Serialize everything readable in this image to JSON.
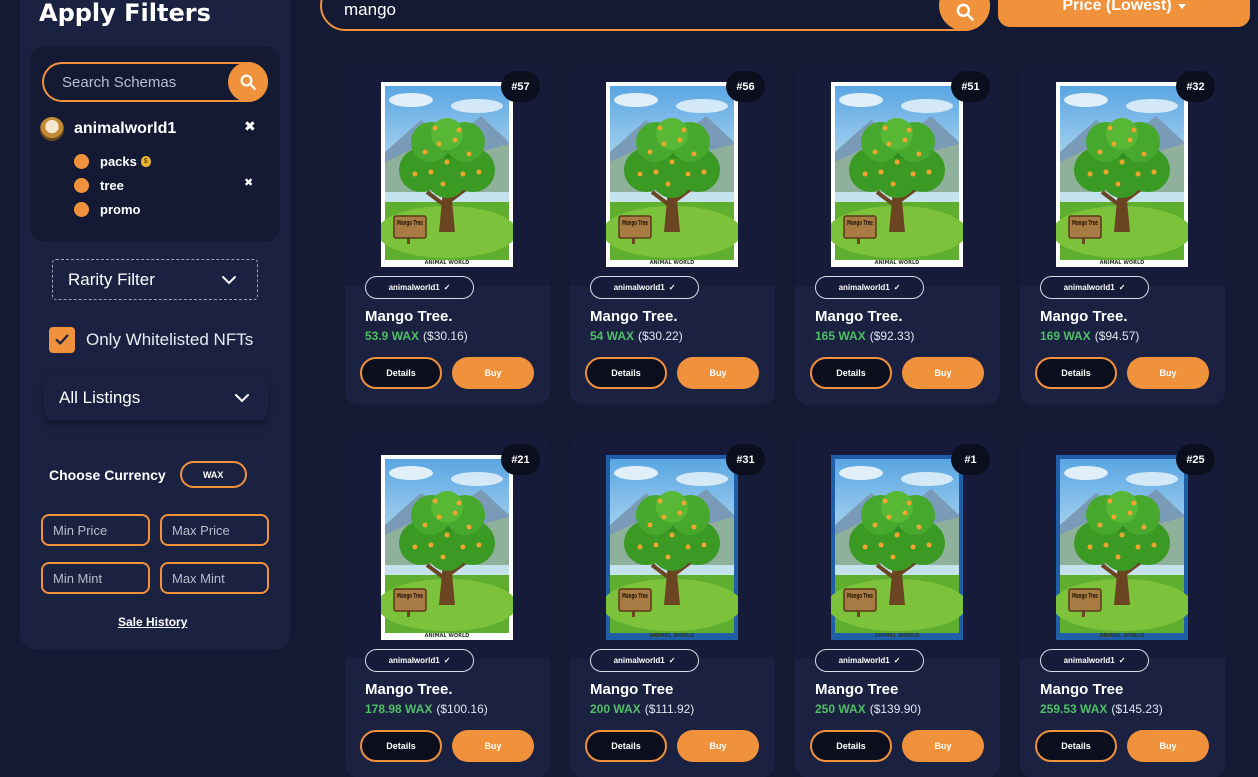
{
  "sidebar": {
    "title": "Apply Filters",
    "schema_search": {
      "placeholder": "Search Schemas"
    },
    "collection": {
      "name": "animalworld1"
    },
    "schemas": [
      {
        "label": "packs",
        "has_coin_icon": true,
        "removable": false
      },
      {
        "label": "tree",
        "has_coin_icon": false,
        "removable": true
      },
      {
        "label": "promo",
        "has_coin_icon": false,
        "removable": false
      }
    ],
    "rarity_filter": "Rarity Filter",
    "whitelisted": {
      "label": "Only Whitelisted NFTs",
      "checked": true
    },
    "listings": "All Listings",
    "currency": {
      "label": "Choose Currency",
      "value": "WAX"
    },
    "min_price": "Min Price",
    "max_price": "Max Price",
    "min_mint": "Min Mint",
    "max_mint": "Max Mint",
    "sale_history": "Sale History"
  },
  "search": {
    "value": "mango"
  },
  "sort": {
    "label": "Price (Lowest)"
  },
  "cards": [
    {
      "mint": "#57",
      "collection": "animalworld1",
      "name": "Mango Tree.",
      "wax": "53.9 WAX",
      "usd": "($30.16)",
      "frame": "white"
    },
    {
      "mint": "#56",
      "collection": "animalworld1",
      "name": "Mango Tree.",
      "wax": "54 WAX",
      "usd": "($30.22)",
      "frame": "white"
    },
    {
      "mint": "#51",
      "collection": "animalworld1",
      "name": "Mango Tree.",
      "wax": "165 WAX",
      "usd": "($92.33)",
      "frame": "white"
    },
    {
      "mint": "#32",
      "collection": "animalworld1",
      "name": "Mango Tree.",
      "wax": "169 WAX",
      "usd": "($94.57)",
      "frame": "white"
    },
    {
      "mint": "#21",
      "collection": "animalworld1",
      "name": "Mango Tree.",
      "wax": "178.98 WAX",
      "usd": "($100.16)",
      "frame": "white"
    },
    {
      "mint": "#31",
      "collection": "animalworld1",
      "name": "Mango Tree",
      "wax": "200 WAX",
      "usd": "($111.92)",
      "frame": "blue"
    },
    {
      "mint": "#1",
      "collection": "animalworld1",
      "name": "Mango Tree",
      "wax": "250 WAX",
      "usd": "($139.90)",
      "frame": "blue"
    },
    {
      "mint": "#25",
      "collection": "animalworld1",
      "name": "Mango Tree",
      "wax": "259.53 WAX",
      "usd": "($145.23)",
      "frame": "blue"
    }
  ],
  "card_labels": {
    "details": "Details",
    "buy": "Buy",
    "sign_text": "Mango Tree",
    "footer_text": "ANIMAL WORLD"
  },
  "colors": {
    "accent": "#f0913b",
    "background": "#141a33",
    "panel": "#1b2141",
    "wax_green": "#4fbf66"
  }
}
